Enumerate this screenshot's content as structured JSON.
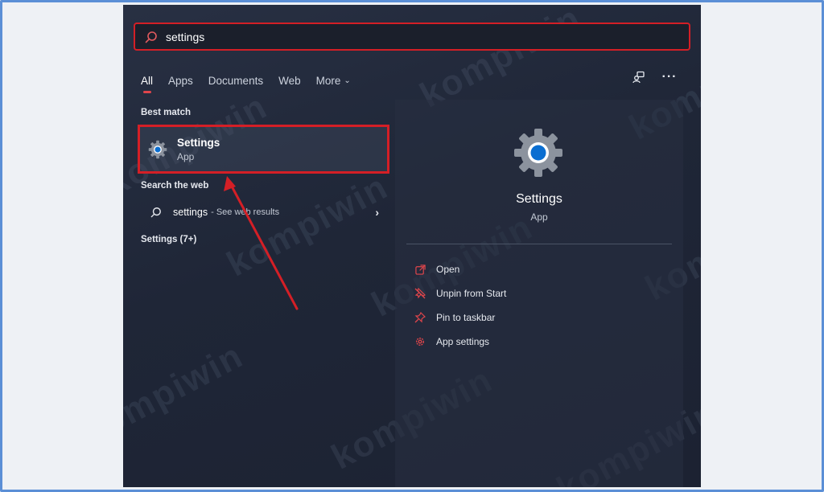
{
  "search": {
    "value": "settings"
  },
  "filters": {
    "tabs": [
      {
        "label": "All",
        "active": true
      },
      {
        "label": "Apps"
      },
      {
        "label": "Documents"
      },
      {
        "label": "Web"
      },
      {
        "label": "More"
      }
    ]
  },
  "best_match": {
    "section_label": "Best match",
    "title": "Settings",
    "subtitle": "App"
  },
  "web": {
    "section_label": "Search the web",
    "term": "settings",
    "suffix": "- See web results"
  },
  "settings_group": {
    "section_label": "Settings (7+)"
  },
  "detail": {
    "title": "Settings",
    "subtitle": "App",
    "actions": [
      {
        "label": "Open",
        "icon": "open-external-icon"
      },
      {
        "label": "Unpin from Start",
        "icon": "unpin-icon"
      },
      {
        "label": "Pin to taskbar",
        "icon": "pin-icon"
      },
      {
        "label": "App settings",
        "icon": "gear-icon"
      }
    ]
  },
  "watermark": {
    "text": "kompiwin"
  },
  "colors": {
    "highlight_red": "#d41f26",
    "accent_blue": "#0a6ed1",
    "panel_bg": "#222a3b",
    "outer_frame": "#5b8fd6"
  }
}
